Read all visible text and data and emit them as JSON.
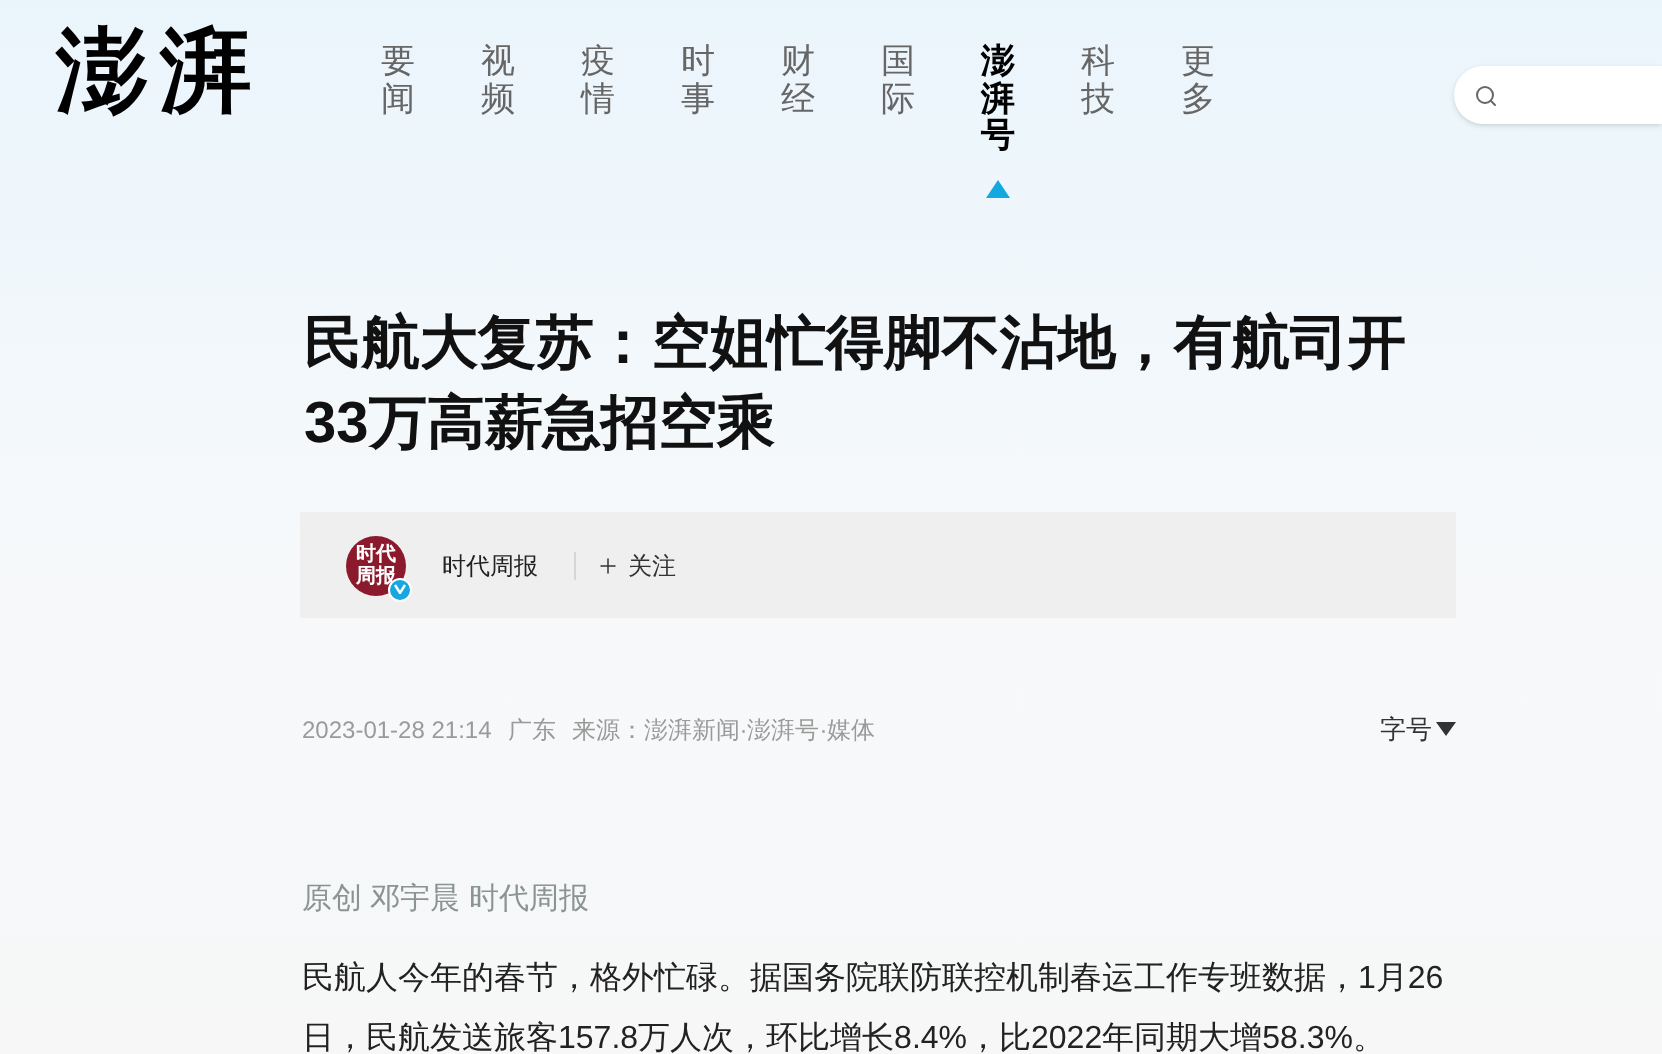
{
  "logo": "澎湃",
  "nav": [
    {
      "label": "要闻",
      "selected": false
    },
    {
      "label": "视频",
      "selected": false
    },
    {
      "label": "疫情",
      "selected": false
    },
    {
      "label": "时事",
      "selected": false
    },
    {
      "label": "财经",
      "selected": false
    },
    {
      "label": "国际",
      "selected": false
    },
    {
      "label": "澎湃号",
      "selected": true
    },
    {
      "label": "科技",
      "selected": false
    },
    {
      "label": "更多",
      "selected": false
    }
  ],
  "article": {
    "title": "民航大复苏：空姐忙得脚不沾地，有航司开33万高薪急招空乘",
    "author": {
      "avatar_text": "时代周报",
      "verified": true,
      "name": "时代周报",
      "follow": "关注"
    },
    "date": "2023-01-28 21:14",
    "location": "广东",
    "source": "来源：澎湃新闻·澎湃号·媒体",
    "font_size": "字号",
    "byline": "原创 邓宇晨 时代周报",
    "body": "民航人今年的春节，格外忙碌。据国务院联防联控机制春运工作专班数据，1月26日，民航发送旅客157.8万人次，环比增长8.4%，比2022年同期大增58.3%。"
  }
}
